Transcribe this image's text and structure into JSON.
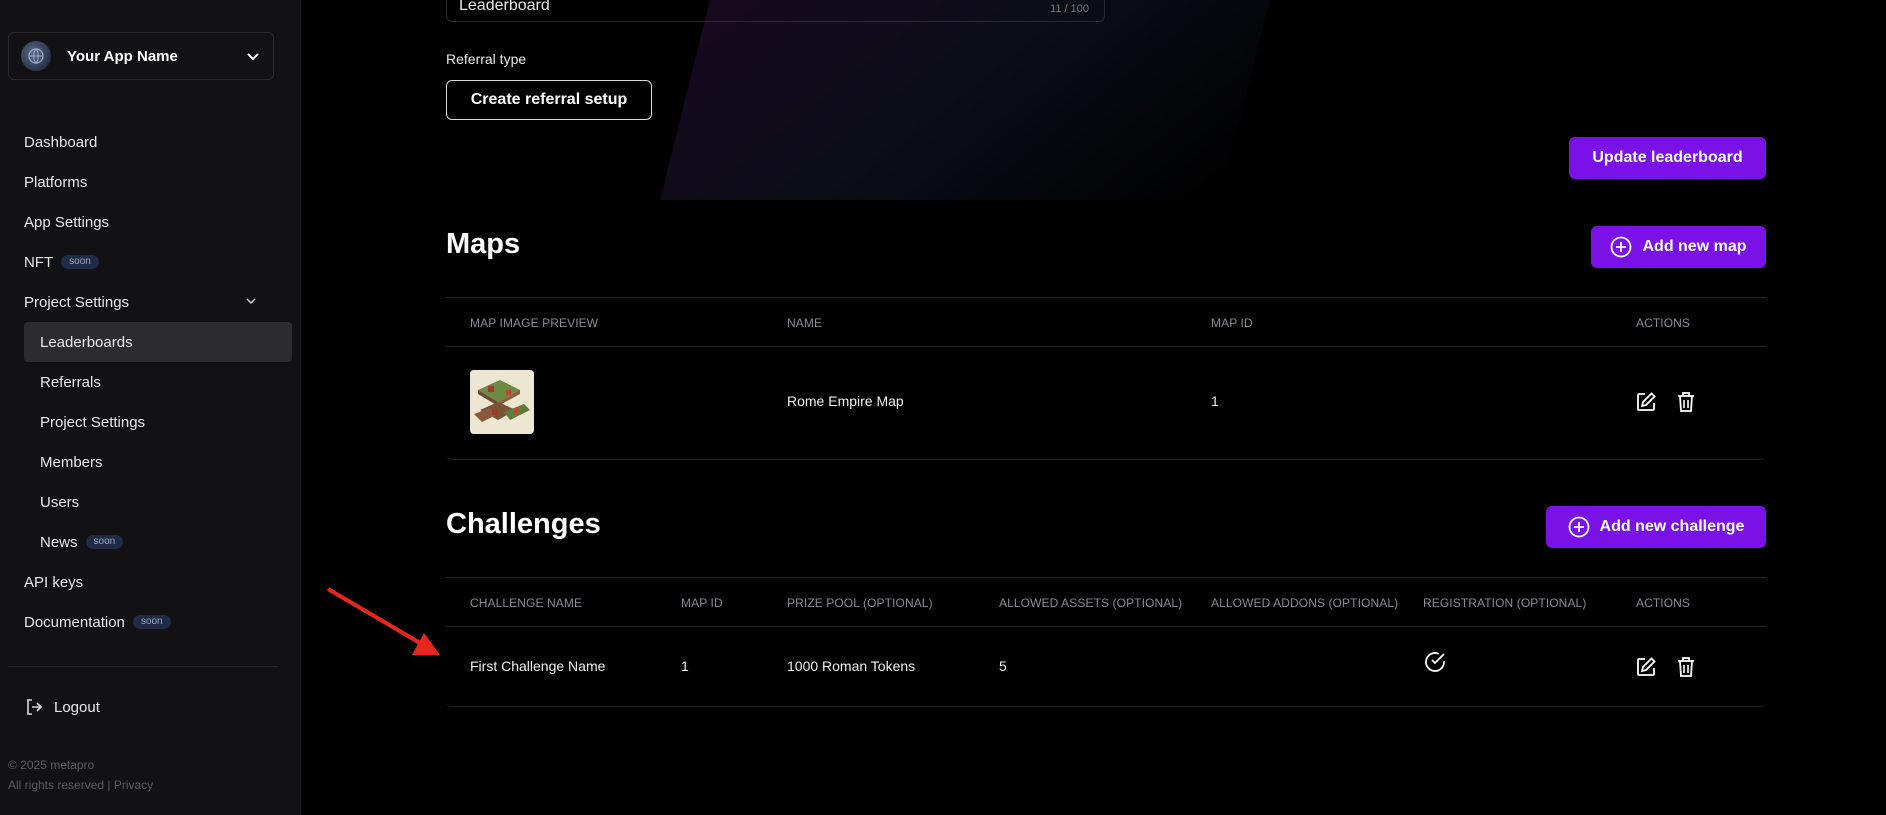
{
  "sidebar": {
    "app_name": "Your App Name",
    "items": [
      {
        "label": "Dashboard"
      },
      {
        "label": "Platforms"
      },
      {
        "label": "App Settings"
      },
      {
        "label": "NFT",
        "badge": "soon"
      },
      {
        "label": "Project Settings"
      },
      {
        "label": "Leaderboards",
        "active": true
      },
      {
        "label": "Referrals"
      },
      {
        "label": "Project Settings"
      },
      {
        "label": "Members"
      },
      {
        "label": "Users"
      },
      {
        "label": "News",
        "badge": "soon"
      },
      {
        "label": "API keys"
      },
      {
        "label": "Documentation",
        "badge": "soon"
      }
    ],
    "logout": "Logout",
    "footer_copyright": "© 2025 metapro",
    "footer_rights": "All rights reserved | Privacy"
  },
  "leaderboard_form": {
    "name_value": "Leaderboard",
    "char_count": "11 / 100",
    "referral_type_label": "Referral type",
    "create_referral_button": "Create referral setup",
    "update_button": "Update leaderboard"
  },
  "maps": {
    "title": "Maps",
    "add_button": "Add new map",
    "columns": [
      "Map image preview",
      "Name",
      "Map ID",
      "Actions"
    ],
    "rows": [
      {
        "name": "Rome Empire Map",
        "map_id": "1"
      }
    ]
  },
  "challenges": {
    "title": "Challenges",
    "add_button": "Add new challenge",
    "columns": [
      "Challenge name",
      "Map ID",
      "Prize pool (optional)",
      "Allowed assets (optional)",
      "Allowed addons (optional)",
      "Registration (optional)",
      "Actions"
    ],
    "rows": [
      {
        "name": "First Challenge Name",
        "map_id": "1",
        "prize_pool": "1000 Roman Tokens",
        "allowed_assets": "5",
        "allowed_addons": "",
        "registration": true
      }
    ]
  },
  "colors": {
    "accent": "#7a12e8",
    "annotation_arrow": "#e8261e"
  }
}
